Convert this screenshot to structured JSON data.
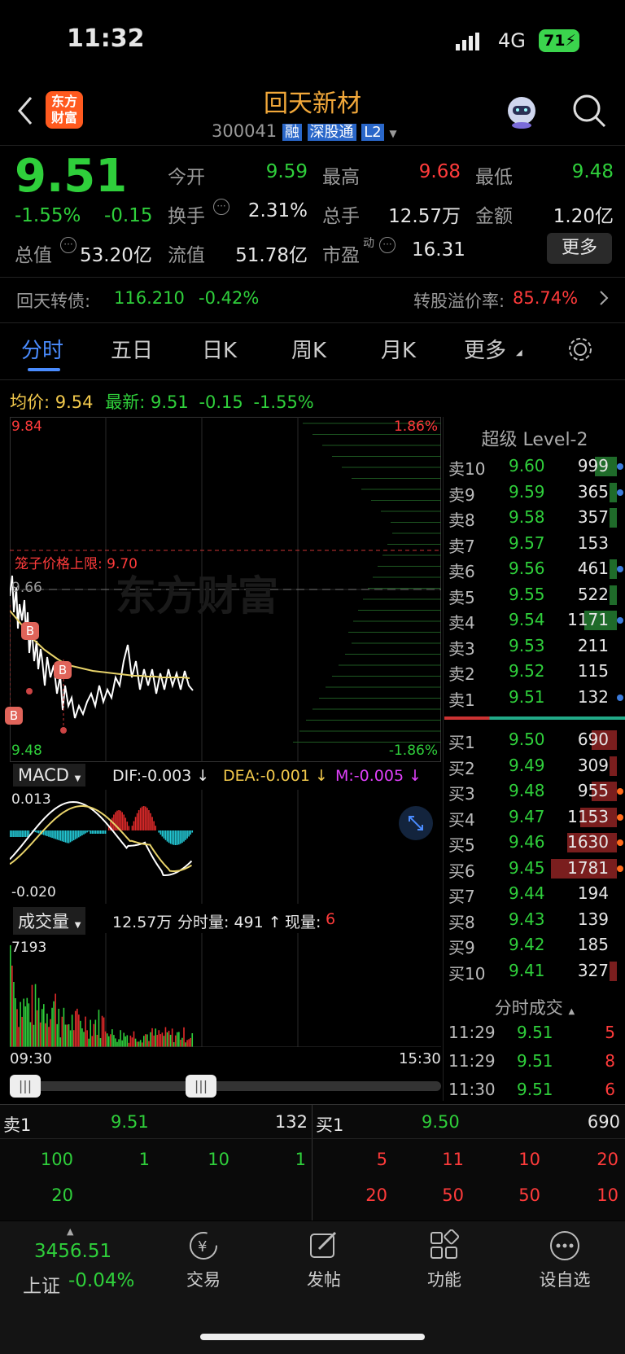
{
  "status": {
    "time": "11:32",
    "network": "4G",
    "battery": "71"
  },
  "header": {
    "title": "回天新材",
    "code": "300041",
    "tag_rong": "融",
    "tag_sgt": "深股通",
    "tag_l2": "L2",
    "logo_line1": "东方",
    "logo_line2": "财富"
  },
  "quote": {
    "price": "9.51",
    "change_pct": "-1.55%",
    "change": "-0.15",
    "open_label": "今开",
    "open": "9.59",
    "high_label": "最高",
    "high": "9.68",
    "low_label": "最低",
    "low": "9.48",
    "turnover_label": "换手",
    "turnover": "2.31%",
    "volume_label": "总手",
    "volume": "12.57万",
    "amount_label": "金额",
    "amount": "1.20亿",
    "mktcap_label": "总值",
    "mktcap": "53.20亿",
    "float_label": "流值",
    "float": "51.78亿",
    "pe_label": "市盈",
    "pe_sup": "动",
    "pe": "16.31",
    "more": "更多"
  },
  "bond": {
    "name": "回天转债:",
    "price": "116.210",
    "change": "-0.42%",
    "premium_label": "转股溢价率:",
    "premium": "85.74%"
  },
  "tabs": [
    "分时",
    "五日",
    "日K",
    "周K",
    "月K",
    "更多"
  ],
  "chart": {
    "avg_label": "均价:",
    "avg": "9.54",
    "last_label": "最新:",
    "last": "9.51",
    "last_chg": "-0.15",
    "last_pct": "-1.55%",
    "ymax": "9.84",
    "ymin": "9.48",
    "pct_max": "1.86%",
    "pct_min": "-1.86%",
    "limit_label": "笼子价格上限: 9.70",
    "ref_price": "9.66",
    "watermark": "东方财富",
    "macd_label": "MACD",
    "dif": "DIF:-0.003 ↓",
    "dea": "DEA:-0.001 ↓",
    "m": "M:-0.005 ↓",
    "macd_max": "0.013",
    "macd_min": "-0.020",
    "vol_label": "成交量",
    "vol_total": "12.57万",
    "vol_seg": "分时量: 491 ↑",
    "vol_now_label": "现量:",
    "vol_now": "6",
    "vol_max": "7193",
    "t_start": "09:30",
    "t_end": "15:30",
    "marker": "B"
  },
  "level2": {
    "title": "超级 Level-2",
    "asks": [
      [
        "卖10",
        "9.60",
        "999"
      ],
      [
        "卖9",
        "9.59",
        "365"
      ],
      [
        "卖8",
        "9.58",
        "357"
      ],
      [
        "卖7",
        "9.57",
        "153"
      ],
      [
        "卖6",
        "9.56",
        "461"
      ],
      [
        "卖5",
        "9.55",
        "522"
      ],
      [
        "卖4",
        "9.54",
        "1171"
      ],
      [
        "卖3",
        "9.53",
        "211"
      ],
      [
        "卖2",
        "9.52",
        "115"
      ],
      [
        "卖1",
        "9.51",
        "132"
      ]
    ],
    "bids": [
      [
        "买1",
        "9.50",
        "690"
      ],
      [
        "买2",
        "9.49",
        "309"
      ],
      [
        "买3",
        "9.48",
        "955"
      ],
      [
        "买4",
        "9.47",
        "1153"
      ],
      [
        "买5",
        "9.46",
        "1630"
      ],
      [
        "买6",
        "9.45",
        "1781"
      ],
      [
        "买7",
        "9.44",
        "194"
      ],
      [
        "买8",
        "9.43",
        "139"
      ],
      [
        "买9",
        "9.42",
        "185"
      ],
      [
        "买10",
        "9.41",
        "327"
      ]
    ],
    "ask_vol_fraction": [
      0.3,
      0.1,
      0.1,
      0.0,
      0.1,
      0.1,
      0.45,
      0.0,
      0.0,
      0.0
    ],
    "bid_vol_fraction": [
      0.35,
      0.1,
      0.35,
      0.5,
      0.68,
      0.9,
      0.0,
      0.0,
      0.0,
      0.1
    ],
    "ticks_title": "分时成交",
    "ticks": [
      [
        "11:29",
        "9.51",
        "5"
      ],
      [
        "11:29",
        "9.51",
        "8"
      ],
      [
        "11:30",
        "9.51",
        "6"
      ]
    ]
  },
  "queue": {
    "ask_label": "卖1",
    "ask_price": "9.51",
    "ask_vol": "132",
    "bid_label": "买1",
    "bid_price": "9.50",
    "bid_vol": "690",
    "ask_orders": [
      "100",
      "1",
      "10",
      "1",
      "20"
    ],
    "bid_orders": [
      "5",
      "11",
      "10",
      "20",
      "20",
      "50",
      "50",
      "10"
    ]
  },
  "nav": {
    "index_value": "3456.51",
    "index_name": "上证",
    "index_chg": "-0.04%",
    "trade": "交易",
    "post": "发帖",
    "func": "功能",
    "watch": "设自选"
  }
}
